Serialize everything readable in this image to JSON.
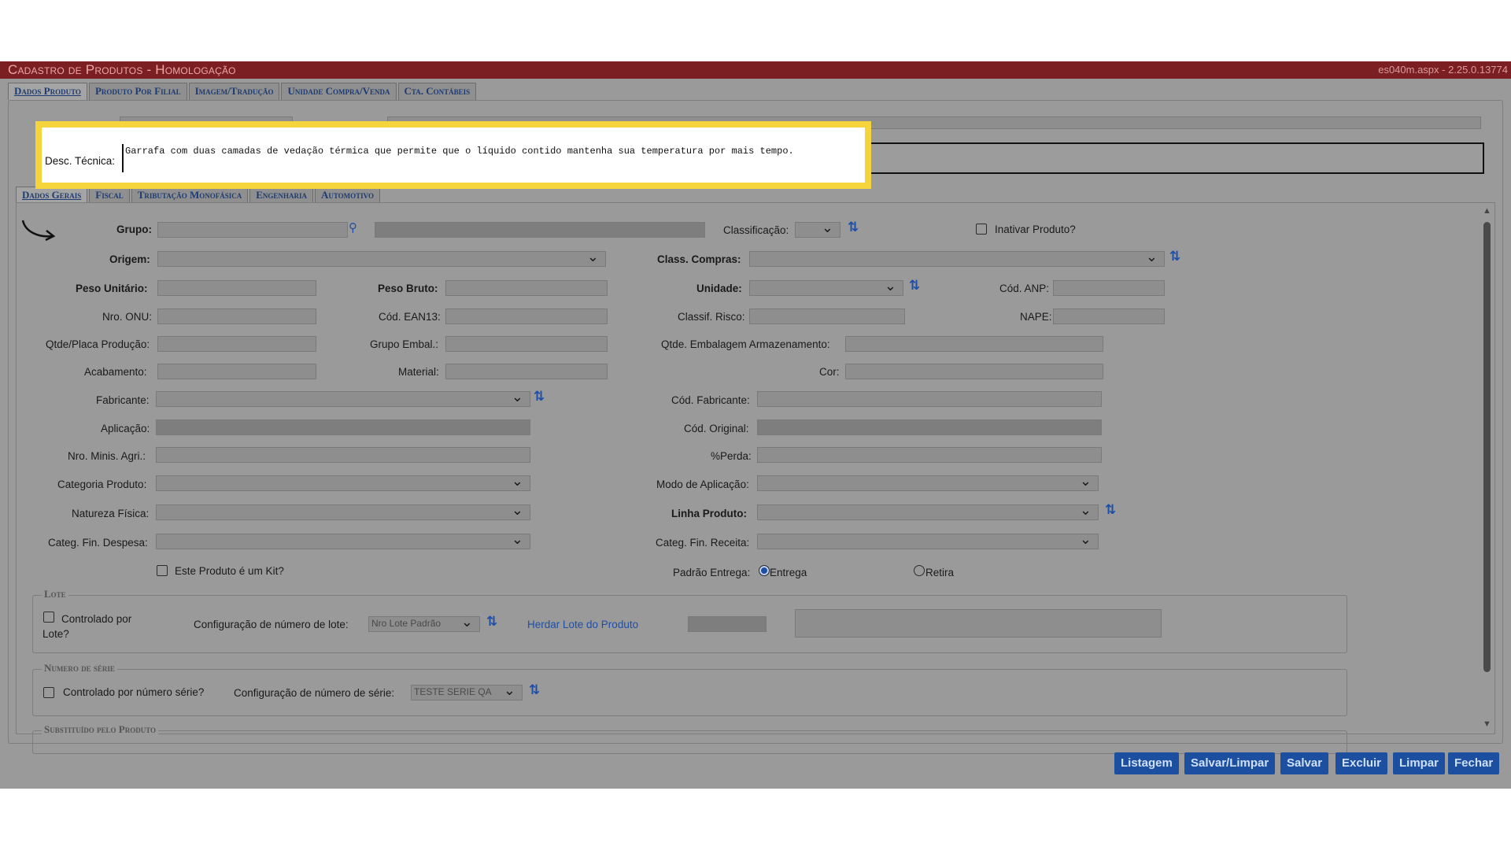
{
  "window": {
    "title": "Cadastro de Produtos - Homologação",
    "version": "es040m.aspx - 2.25.0.13774"
  },
  "top_tabs": [
    "Dados Produto",
    "Produto Por Filial",
    "Imagem/Tradução",
    "Unidade Compra/Venda",
    "Cta. Contábeis"
  ],
  "header": {
    "desc_tecnica_label": "Desc. Técnica:",
    "desc_tecnica_value": "Garrafa com duas camadas de vedação térmica que permite que o líquido contido mantenha sua temperatura por mais tempo."
  },
  "sub_tabs": [
    "Dados Gerais",
    "Fiscal",
    "Tributação Monofásica",
    "Engenharia",
    "Automotivo"
  ],
  "form": {
    "grupo": "Grupo:",
    "classificacao": "Classificação:",
    "inativar": "Inativar Produto?",
    "origem": "Origem:",
    "class_compras": "Class. Compras:",
    "peso_unitario": "Peso Unitário:",
    "peso_bruto": "Peso Bruto:",
    "unidade": "Unidade:",
    "cod_anp": "Cód. ANP:",
    "nro_onu": "Nro. ONU:",
    "cod_ean13": "Cód. EAN13:",
    "classif_risco": "Classif. Risco:",
    "nape": "NAPE:",
    "qtde_placa": "Qtde/Placa Produção:",
    "grupo_embal": "Grupo Embal.:",
    "qtde_emb_arm": "Qtde. Embalagem Armazenamento:",
    "acabamento": "Acabamento:",
    "material": "Material:",
    "cor": "Cor:",
    "fabricante": "Fabricante:",
    "cod_fabricante": "Cód. Fabricante:",
    "aplicacao": "Aplicação:",
    "cod_original": "Cód. Original:",
    "nro_minis_agri": "Nro. Minis. Agri.:",
    "perda": "%Perda:",
    "categoria_produto": "Categoria Produto:",
    "modo_aplicacao": "Modo de Aplicação:",
    "natureza_fisica": "Natureza Física:",
    "linha_produto": "Linha Produto:",
    "categ_fin_despesa": "Categ. Fin. Despesa:",
    "categ_fin_receita": "Categ. Fin. Receita:",
    "kit": "Este Produto é um Kit?",
    "padrao_entrega": "Padrão Entrega:",
    "entrega": "Entrega",
    "retira": "Retira"
  },
  "lote": {
    "legend": "Lote",
    "controlado": "Controlado por Lote?",
    "config_label": "Configuração de número de lote:",
    "config_value": "Nro Lote Padrão",
    "herdar": "Herdar Lote do Produto"
  },
  "serie": {
    "legend": "Numero de série",
    "controlado": "Controlado por número série?",
    "config_label": "Configuração de número de série:",
    "config_value": "TESTE SERIE QA"
  },
  "substituido": {
    "legend": "Substituído pelo Produto"
  },
  "buttons": [
    "Listagem",
    "Salvar/Limpar",
    "Salvar",
    "Excluir",
    "Limpar",
    "Fechar"
  ]
}
